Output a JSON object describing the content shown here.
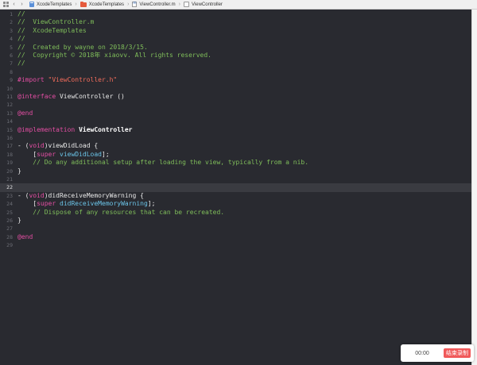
{
  "jumpbar": {
    "crumbs": [
      {
        "label": "XcodeTemplates",
        "icon": "project-icon"
      },
      {
        "label": "XcodeTemplates",
        "icon": "folder-icon"
      },
      {
        "label": "ViewController.m",
        "icon": "objc-file-icon"
      },
      {
        "label": "ViewController",
        "icon": "symbol-icon"
      }
    ]
  },
  "editor": {
    "current_line": 22,
    "lines": [
      {
        "n": "1",
        "tokens": [
          {
            "t": "//",
            "c": "comment"
          }
        ]
      },
      {
        "n": "2",
        "tokens": [
          {
            "t": "//  ViewController.m",
            "c": "comment"
          }
        ]
      },
      {
        "n": "3",
        "tokens": [
          {
            "t": "//  XcodeTemplates",
            "c": "comment"
          }
        ]
      },
      {
        "n": "4",
        "tokens": [
          {
            "t": "//",
            "c": "comment"
          }
        ]
      },
      {
        "n": "5",
        "tokens": [
          {
            "t": "//  Created by wayne on 2018/3/15.",
            "c": "comment"
          }
        ]
      },
      {
        "n": "6",
        "tokens": [
          {
            "t": "//  Copyright © 2018年 xiaovv. All rights reserved.",
            "c": "comment"
          }
        ]
      },
      {
        "n": "7",
        "tokens": [
          {
            "t": "//",
            "c": "comment"
          }
        ]
      },
      {
        "n": "8",
        "tokens": []
      },
      {
        "n": "9",
        "tokens": [
          {
            "t": "#import ",
            "c": "keyword"
          },
          {
            "t": "\"ViewController.h\"",
            "c": "string"
          }
        ]
      },
      {
        "n": "10",
        "tokens": []
      },
      {
        "n": "11",
        "tokens": [
          {
            "t": "@interface",
            "c": "keyword"
          },
          {
            "t": " ViewController ()",
            "c": "plain"
          }
        ]
      },
      {
        "n": "12",
        "tokens": []
      },
      {
        "n": "13",
        "tokens": [
          {
            "t": "@end",
            "c": "keyword"
          }
        ]
      },
      {
        "n": "14",
        "tokens": []
      },
      {
        "n": "15",
        "tokens": [
          {
            "t": "@implementation",
            "c": "keyword"
          },
          {
            "t": " ViewController",
            "c": "bold"
          }
        ]
      },
      {
        "n": "16",
        "tokens": []
      },
      {
        "n": "17",
        "tokens": [
          {
            "t": "- (",
            "c": "plain"
          },
          {
            "t": "void",
            "c": "keyword"
          },
          {
            "t": ")viewDidLoad {",
            "c": "plain"
          }
        ]
      },
      {
        "n": "18",
        "tokens": [
          {
            "t": "    [",
            "c": "plain"
          },
          {
            "t": "super",
            "c": "keyword"
          },
          {
            "t": " ",
            "c": "plain"
          },
          {
            "t": "viewDidLoad",
            "c": "method"
          },
          {
            "t": "];",
            "c": "plain"
          }
        ]
      },
      {
        "n": "19",
        "tokens": [
          {
            "t": "    // Do any additional setup after loading the view, typically from a nib.",
            "c": "comment"
          }
        ]
      },
      {
        "n": "20",
        "tokens": [
          {
            "t": "}",
            "c": "plain"
          }
        ]
      },
      {
        "n": "21",
        "tokens": []
      },
      {
        "n": "22",
        "tokens": []
      },
      {
        "n": "23",
        "tokens": [
          {
            "t": "- (",
            "c": "plain"
          },
          {
            "t": "void",
            "c": "keyword"
          },
          {
            "t": ")didReceiveMemoryWarning {",
            "c": "plain"
          }
        ]
      },
      {
        "n": "24",
        "tokens": [
          {
            "t": "    [",
            "c": "plain"
          },
          {
            "t": "super",
            "c": "keyword"
          },
          {
            "t": " ",
            "c": "plain"
          },
          {
            "t": "didReceiveMemoryWarning",
            "c": "method"
          },
          {
            "t": "];",
            "c": "plain"
          }
        ]
      },
      {
        "n": "25",
        "tokens": [
          {
            "t": "    // Dispose of any resources that can be recreated.",
            "c": "comment"
          }
        ]
      },
      {
        "n": "26",
        "tokens": [
          {
            "t": "}",
            "c": "plain"
          }
        ]
      },
      {
        "n": "27",
        "tokens": []
      },
      {
        "n": "28",
        "tokens": [
          {
            "t": "@end",
            "c": "keyword"
          }
        ]
      },
      {
        "n": "29",
        "tokens": []
      }
    ]
  },
  "recorder": {
    "time": "00:00",
    "stop_label": "结束录制"
  },
  "colors": {
    "editor_bg": "#292a30",
    "current_line_bg": "#3a3b41",
    "comment": "#7fbd5a",
    "keyword": "#e34ea3",
    "string": "#f26c5b",
    "method": "#6bc4e8",
    "record_button": "#f0595a"
  }
}
